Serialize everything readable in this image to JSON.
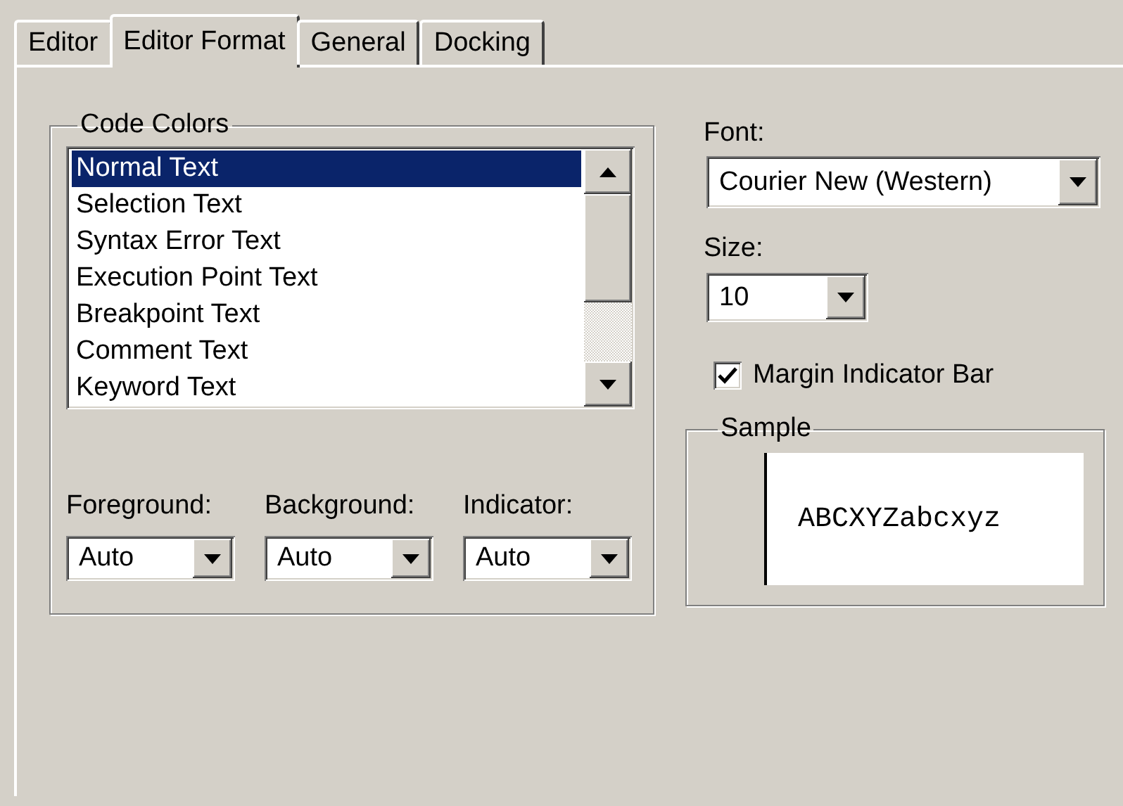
{
  "tabs": [
    {
      "label": "Editor",
      "selected": false
    },
    {
      "label": "Editor Format",
      "selected": true
    },
    {
      "label": "General",
      "selected": false
    },
    {
      "label": "Docking",
      "selected": false
    }
  ],
  "code_colors": {
    "title": "Code Colors",
    "items": [
      {
        "label": "Normal Text",
        "selected": true
      },
      {
        "label": "Selection Text",
        "selected": false
      },
      {
        "label": "Syntax Error Text",
        "selected": false
      },
      {
        "label": "Execution Point Text",
        "selected": false
      },
      {
        "label": "Breakpoint Text",
        "selected": false
      },
      {
        "label": "Comment Text",
        "selected": false
      },
      {
        "label": "Keyword Text",
        "selected": false
      }
    ],
    "dropdowns": [
      {
        "label": "Foreground:",
        "value": "Auto"
      },
      {
        "label": "Background:",
        "value": "Auto"
      },
      {
        "label": "Indicator:",
        "value": "Auto"
      }
    ]
  },
  "font": {
    "label": "Font:",
    "value": "Courier New (Western)"
  },
  "size": {
    "label": "Size:",
    "value": "10"
  },
  "margin_indicator_bar": {
    "label": "Margin Indicator Bar",
    "checked": true
  },
  "sample": {
    "title": "Sample",
    "text": "ABCXYZabcxyz"
  }
}
